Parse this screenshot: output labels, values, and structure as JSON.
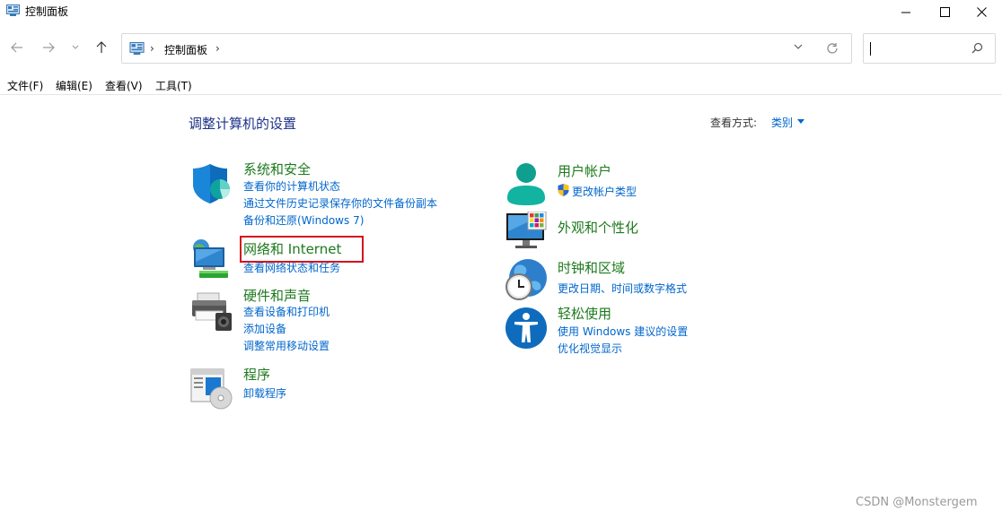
{
  "window": {
    "title": "控制面板"
  },
  "nav": {
    "breadcrumb": "控制面板",
    "separator": "›",
    "search_placeholder": ""
  },
  "menu": [
    "文件(F)",
    "编辑(E)",
    "查看(V)",
    "工具(T)"
  ],
  "content": {
    "title": "调整计算机的设置",
    "viewby_label": "查看方式:",
    "viewby_value": "类别"
  },
  "categories": [
    {
      "title": "系统和安全",
      "icon": "shield-icon",
      "links": [
        "查看你的计算机状态",
        "通过文件历史记录保存你的文件备份副本",
        "备份和还原(Windows 7)"
      ]
    },
    {
      "title": "网络和 Internet",
      "icon": "network-icon",
      "links": [
        "查看网络状态和任务"
      ]
    },
    {
      "title": "硬件和声音",
      "icon": "printer-icon",
      "links": [
        "查看设备和打印机",
        "添加设备",
        "调整常用移动设置"
      ]
    },
    {
      "title": "程序",
      "icon": "programs-icon",
      "links": [
        "卸载程序"
      ]
    },
    {
      "title": "用户帐户",
      "icon": "user-icon",
      "links": [
        "更改帐户类型"
      ]
    },
    {
      "title": "外观和个性化",
      "icon": "monitor-icon",
      "links": []
    },
    {
      "title": "时钟和区域",
      "icon": "clock-globe-icon",
      "links": [
        "更改日期、时间或数字格式"
      ]
    },
    {
      "title": "轻松使用",
      "icon": "accessibility-icon",
      "links": [
        "使用 Windows 建议的设置",
        "优化视觉显示"
      ]
    }
  ],
  "watermark": "CSDN @Monstergem",
  "colors": {
    "category_title": "#1d7a1d",
    "link": "#0066cc",
    "page_title": "#1e3287",
    "highlight": "#d4131f"
  }
}
